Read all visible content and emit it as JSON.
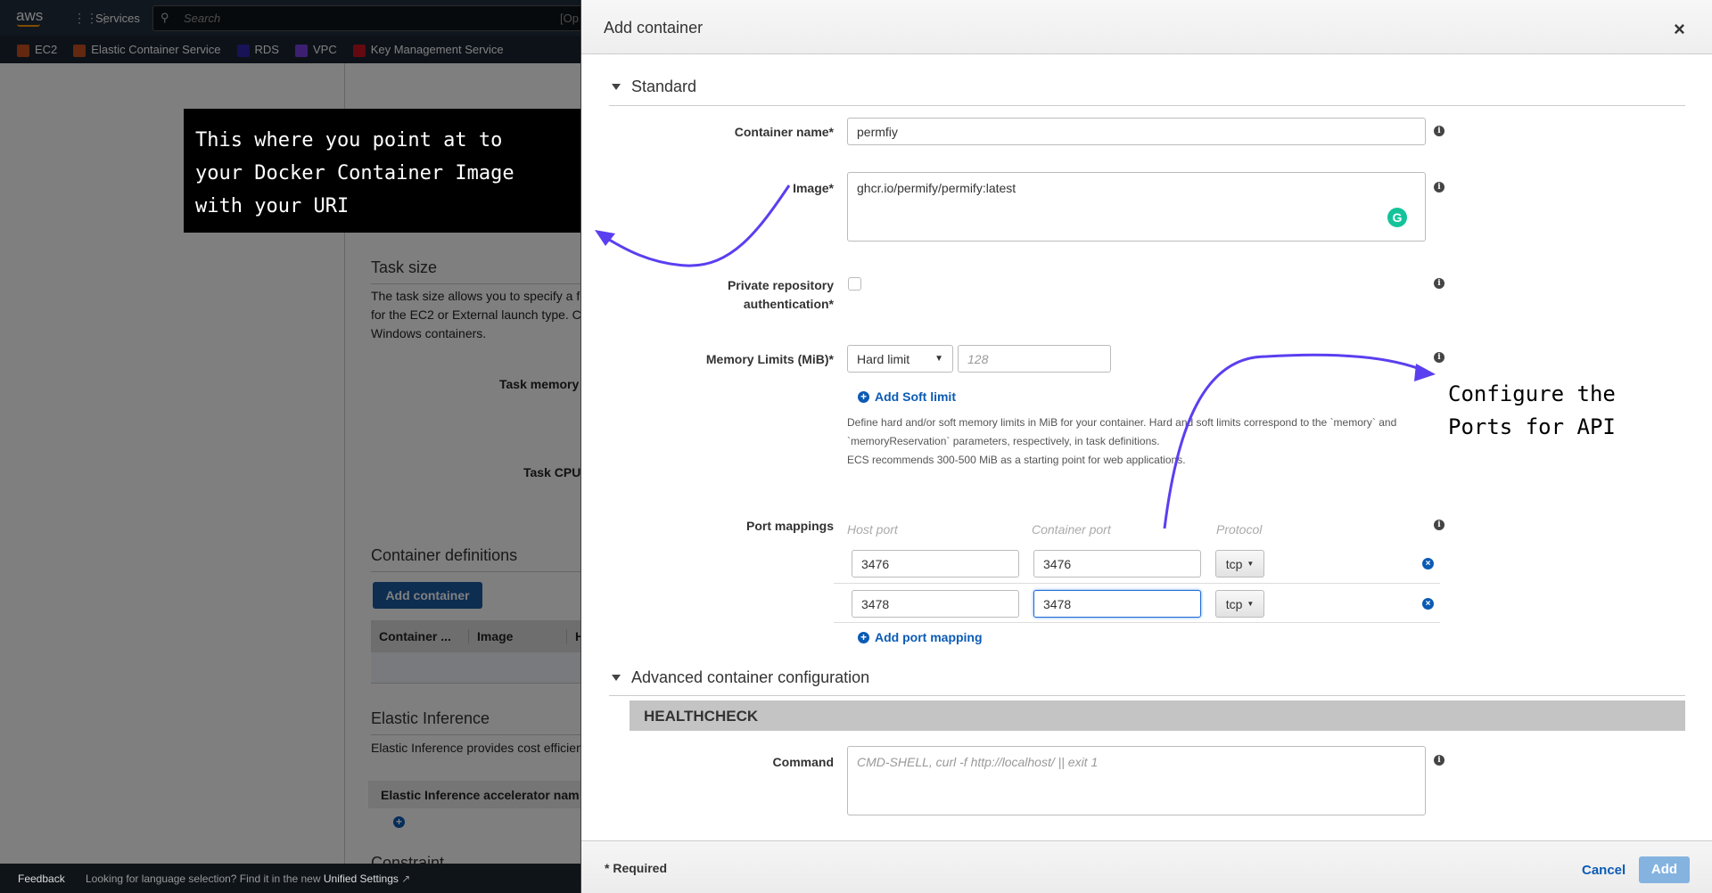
{
  "topnav": {
    "logo": "aws",
    "services": "Services",
    "search_placeholder": "Search",
    "search_shortcut": "[Op",
    "favorites": [
      {
        "label": "EC2",
        "color": "#c7511f"
      },
      {
        "label": "Elastic Container Service",
        "color": "#c7511f"
      },
      {
        "label": "RDS",
        "color": "#2e27ad"
      },
      {
        "label": "VPC",
        "color": "#7b3fe4"
      },
      {
        "label": "Key Management Service",
        "color": "#c7131f"
      }
    ]
  },
  "background_page": {
    "task_size_title": "Task size",
    "task_size_desc": [
      "The task size allows you to specify a f",
      "for the EC2 or External launch type. C",
      "Windows containers."
    ],
    "task_memory": "Task memory",
    "task_cpu": "Task CPU",
    "container_definitions": "Container definitions",
    "add_container": "Add container",
    "table_headers": [
      "Container ...",
      "Image",
      "H"
    ],
    "elastic_inference": "Elastic Inference",
    "elastic_desc": "Elastic Inference provides cost efficien",
    "accelerator_header": "Elastic Inference accelerator nam",
    "constraint": "Constraint"
  },
  "footer": {
    "feedback": "Feedback",
    "language_msg": "Looking for language selection? Find it in the new",
    "unified_settings": "Unified Settings"
  },
  "annotations": {
    "callout": [
      "This where you point at to",
      "your Docker Container Image",
      "with your URI"
    ],
    "ports_note": [
      "Configure the",
      "Ports for API"
    ],
    "arrow_color": "#5a3ff0"
  },
  "dialog": {
    "title": "Add container",
    "close": "×",
    "standard": "Standard",
    "container_name": {
      "label": "Container name*",
      "value": "permfiy"
    },
    "image": {
      "label": "Image*",
      "value": "ghcr.io/permify/permify:latest"
    },
    "private_repo": {
      "label1": "Private repository",
      "label2": "authentication*",
      "checked": false
    },
    "memory": {
      "label": "Memory Limits (MiB)*",
      "type": "Hard limit",
      "placeholder": "128",
      "add_soft": "Add Soft limit",
      "help": [
        "Define hard and/or soft memory limits in MiB for your container. Hard and soft limits correspond to the `memory` and",
        "`memoryReservation` parameters, respectively, in task definitions.",
        "ECS recommends 300-500 MiB as a starting point for web applications."
      ]
    },
    "ports": {
      "label": "Port mappings",
      "headers": [
        "Host port",
        "Container port",
        "Protocol"
      ],
      "rows": [
        {
          "host": "3476",
          "container": "3476",
          "protocol": "tcp"
        },
        {
          "host": "3478",
          "container": "3478",
          "protocol": "tcp"
        }
      ],
      "add": "Add port mapping"
    },
    "advanced": "Advanced container configuration",
    "healthcheck": "HEALTHCHECK",
    "command": {
      "label": "Command",
      "placeholder": "CMD-SHELL, curl -f http://localhost/ || exit 1"
    },
    "required": "* Required",
    "cancel": "Cancel",
    "add": "Add"
  }
}
